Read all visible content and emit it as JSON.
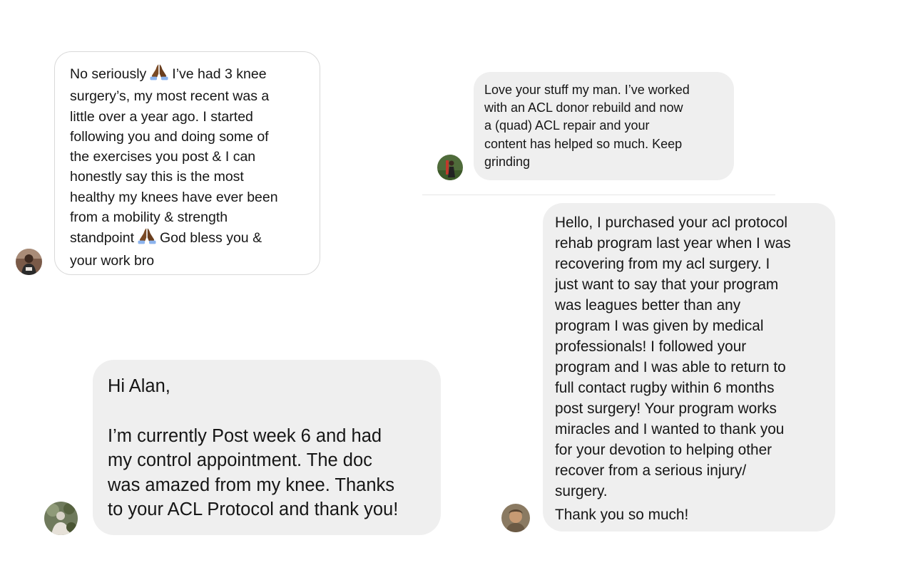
{
  "messages": [
    {
      "lines": [
        "No seriously",
        "I’ve had 3 knee",
        "surgery’s, my most recent was a",
        "little over a year ago. I started",
        "following you and doing some of",
        "the exercises you post & I can",
        "honestly say this is the most",
        "healthy my knees have ever been",
        "from a mobility & strength",
        "standpoint",
        "God bless you &",
        "your work bro"
      ]
    },
    {
      "lines": [
        "Love your stuff my man. I’ve worked",
        "with an ACL donor rebuild and now",
        "a (quad) ACL repair and your",
        "content has helped so much. Keep",
        "grinding"
      ]
    },
    {
      "lines": [
        "Hello, I purchased your acl protocol",
        "rehab program last year when I was",
        "recovering from my acl surgery. I",
        "just want to say that your program",
        "was leagues better than any",
        "program I was given by medical",
        "professionals! I followed your",
        "program and I was able to return to",
        "full contact rugby within 6 months",
        "post surgery! Your program works",
        "miracles and I wanted to thank you",
        "for your devotion to helping other",
        "recover from a serious injury/",
        "surgery.",
        "Thank you so much!"
      ]
    },
    {
      "lines": [
        "Hi Alan,",
        "I’m currently Post week 6 and had",
        "my control appointment. The doc",
        "was amazed from my knee. Thanks",
        "to your ACL Protocol and thank you!"
      ]
    }
  ],
  "icons": {
    "praying_hands": "praying-hands-emoji",
    "avatar": "user-avatar-photo"
  }
}
